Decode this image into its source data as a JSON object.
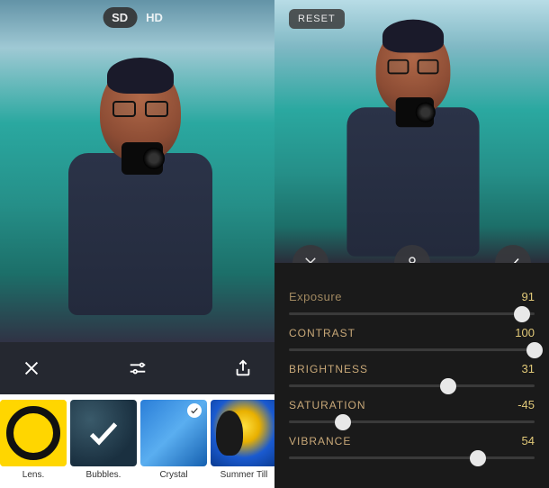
{
  "left": {
    "quality": {
      "sd": "SD",
      "hd": "HD",
      "selected": "SD"
    },
    "toolbar": {
      "close": "close",
      "adjust": "adjust",
      "share": "share"
    },
    "filters": [
      {
        "key": "lens",
        "label": "Lens.",
        "active": true,
        "applied": false
      },
      {
        "key": "bubbles",
        "label": "Bubbles.",
        "active": false,
        "applied": true
      },
      {
        "key": "crystal",
        "label": "Crystal",
        "active": false,
        "applied": true
      },
      {
        "key": "summer",
        "label": "Summer Till",
        "active": false,
        "applied": false
      }
    ]
  },
  "right": {
    "reset": "RESET",
    "actions": {
      "cancel": "cancel",
      "profile": "profile",
      "confirm": "confirm"
    },
    "sliders": [
      {
        "key": "exposure",
        "label": "Exposure",
        "value": 91,
        "min": -100,
        "max": 100,
        "pos": 95
      },
      {
        "key": "contrast",
        "label": "CONTRAST",
        "value": 100,
        "min": -100,
        "max": 100,
        "pos": 100
      },
      {
        "key": "brightness",
        "label": "BRIGHTNESS",
        "value": 31,
        "min": -100,
        "max": 100,
        "pos": 65
      },
      {
        "key": "saturation",
        "label": "SATURATION",
        "value": -45,
        "min": -100,
        "max": 100,
        "pos": 22
      },
      {
        "key": "vibrance",
        "label": "VIBRANCE",
        "value": 54,
        "min": -100,
        "max": 100,
        "pos": 77
      }
    ]
  }
}
